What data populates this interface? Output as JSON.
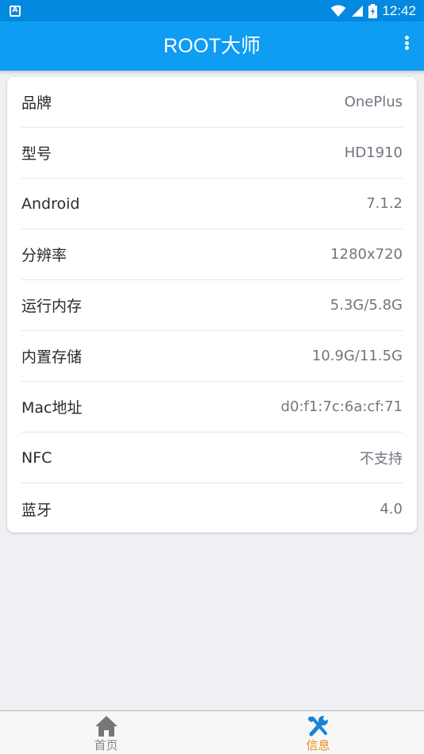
{
  "status_bar": {
    "notification_icon_letter": "A",
    "time": "12:42"
  },
  "app_bar": {
    "title": "ROOT大师"
  },
  "info": {
    "rows": [
      {
        "label": "品牌",
        "value": "OnePlus"
      },
      {
        "label": "型号",
        "value": "HD1910"
      },
      {
        "label": "Android",
        "value": "7.1.2"
      },
      {
        "label": "分辨率",
        "value": "1280x720"
      },
      {
        "label": "运行内存",
        "value": "5.3G/5.8G"
      },
      {
        "label": "内置存储",
        "value": "10.9G/11.5G"
      },
      {
        "label": "Mac地址",
        "value": "d0:f1:7c:6a:cf:71"
      },
      {
        "label": "NFC",
        "value": "不支持"
      },
      {
        "label": "蓝牙",
        "value": "4.0"
      }
    ]
  },
  "bottom_nav": {
    "items": [
      {
        "label": "首页",
        "icon": "home-icon",
        "active": false
      },
      {
        "label": "信息",
        "icon": "tools-icon",
        "active": true
      }
    ],
    "active_color": "#f08a12",
    "inactive_color": "#888888"
  },
  "colors": {
    "status_bar": "#0489e0",
    "app_bar": "#0f9cf3",
    "background": "#eff0f4",
    "tools_icon": "#1784d8"
  }
}
